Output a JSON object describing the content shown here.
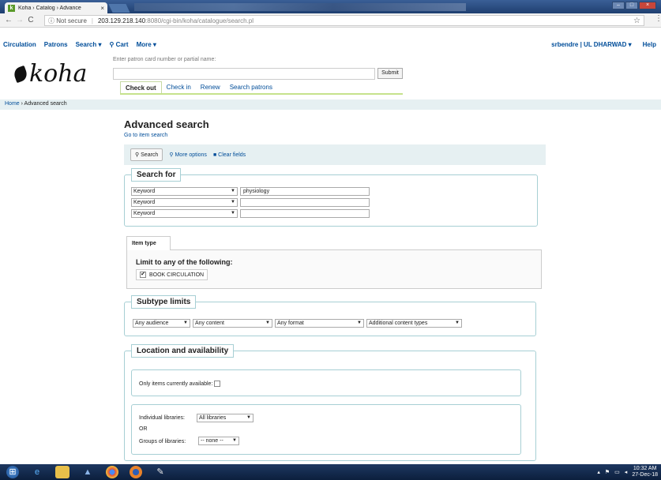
{
  "browser": {
    "tab_title": "Koha › Catalog › Advance",
    "tab_close": "×",
    "secure_label": "ⓘ Not secure",
    "url_host": "203.129.218.140",
    "url_path": ":8080/cgi-bin/koha/catalogue/search.pl"
  },
  "topnav": {
    "left": [
      "Circulation",
      "Patrons",
      "Search ▾",
      "⚲ Cart",
      "More ▾"
    ],
    "user": "srbendre | UL DHARWAD ▾",
    "help": "Help"
  },
  "logo_text": "koha",
  "patron": {
    "label": "Enter patron card number or partial name:",
    "submit": "Submit"
  },
  "circ_tabs": [
    "Check out",
    "Check in",
    "Renew",
    "Search patrons"
  ],
  "breadcrumb": {
    "home": "Home",
    "sep": " › ",
    "current": "Advanced search"
  },
  "main": {
    "title": "Advanced search",
    "item_search_link": "Go to item search",
    "toolbar": {
      "search": "Search",
      "more_options": "More options",
      "clear_fields": "Clear fields"
    }
  },
  "search_for": {
    "legend": "Search for",
    "rows": [
      {
        "index": "Keyword",
        "term": "physiology"
      },
      {
        "index": "Keyword",
        "term": ""
      },
      {
        "index": "Keyword",
        "term": ""
      }
    ]
  },
  "item_type": {
    "tab": "Item type",
    "limit_label": "Limit to any of the following:",
    "checkbox_label": "BOOK CIRCULATION",
    "checked": true
  },
  "subtype": {
    "legend": "Subtype limits",
    "selects": [
      "Any audience",
      "Any content",
      "Any format",
      "Additional content types"
    ]
  },
  "location": {
    "legend": "Location and availability",
    "only_available": "Only items currently available:",
    "individual_label": "Individual libraries:",
    "individual_value": "All libraries",
    "or": "OR",
    "groups_label": "Groups of libraries:",
    "groups_value": "-- none --"
  },
  "taskbar": {
    "clock": "10:32 AM",
    "date": "27-Dec-18"
  }
}
